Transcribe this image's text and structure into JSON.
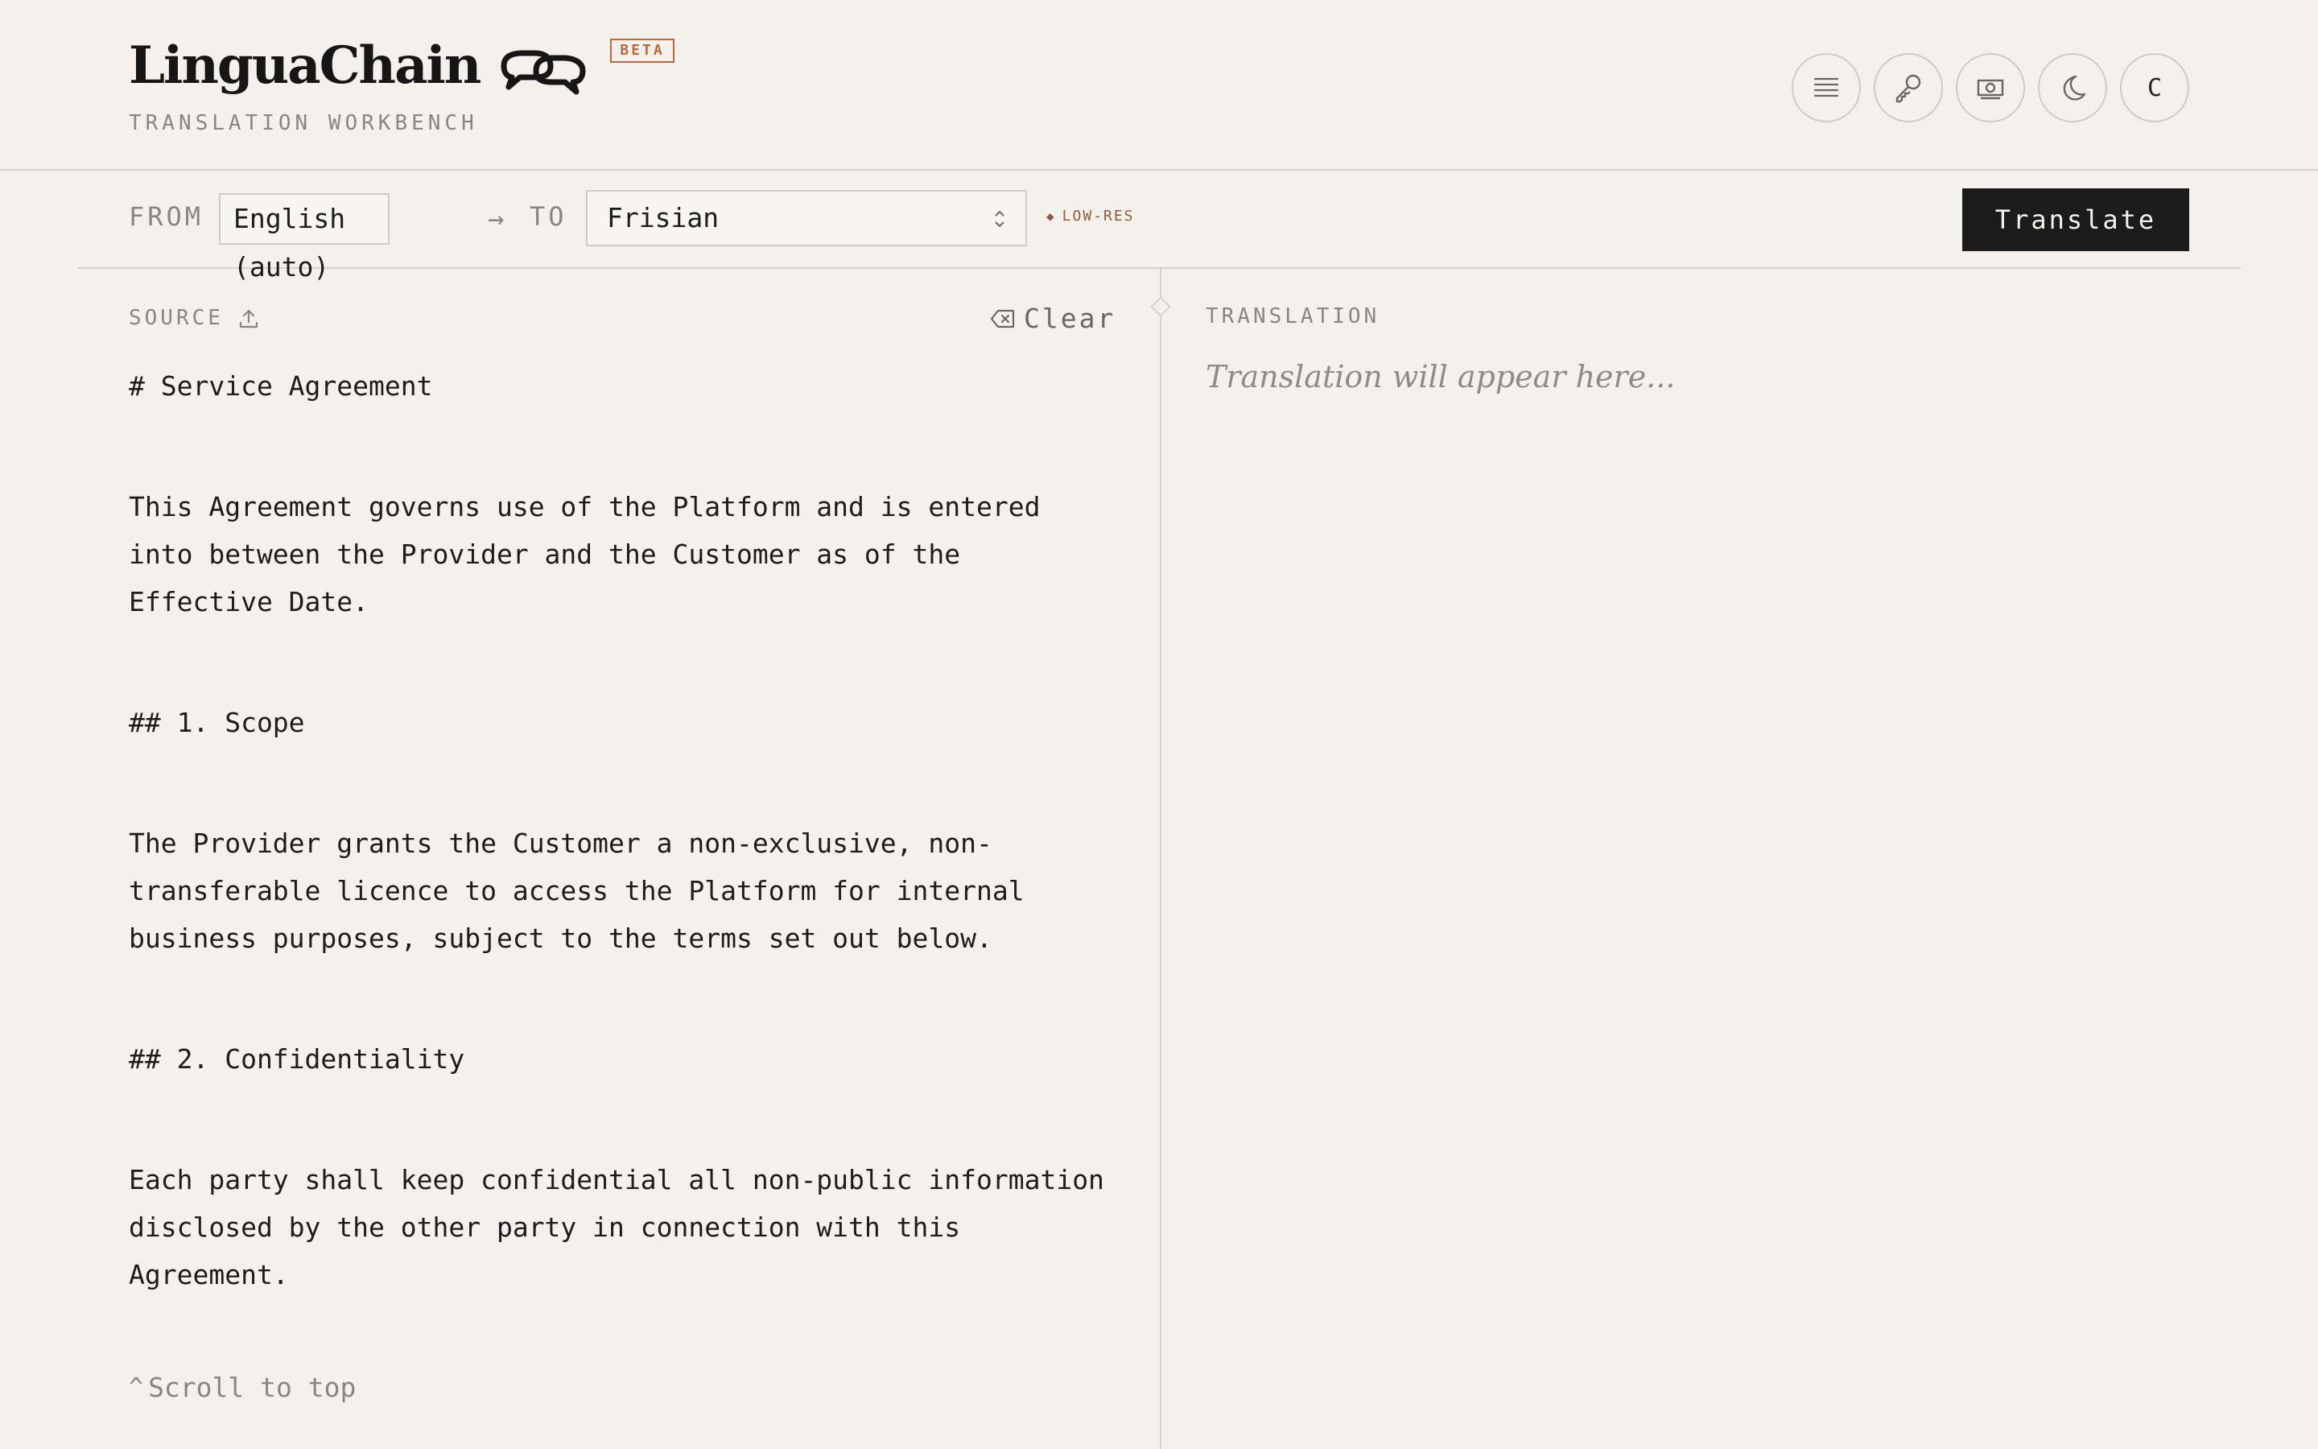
{
  "header": {
    "brand": "LinguaChain",
    "badge": "BETA",
    "subtitle": "TRANSLATION WORKBENCH",
    "icons": [
      "menu-icon",
      "key-icon",
      "money-icon",
      "moon-icon"
    ],
    "avatar_letter": "C"
  },
  "langbar": {
    "from_label": "FROM",
    "source_language": "English (auto)",
    "arrow": "→",
    "to_label": "TO",
    "target_language": "Frisian",
    "resource_badge": "LOW-RES",
    "translate_label": "Translate"
  },
  "source": {
    "label": "SOURCE",
    "clear_label": "Clear",
    "paragraphs": [
      "# Service Agreement",
      "This Agreement governs use of the Platform and is entered into between the Provider and the Customer as of the Effective Date.",
      "## 1. Scope",
      "The Provider grants the Customer a non-exclusive, non-transferable licence to access the Platform for internal business purposes, subject to the terms set out below.",
      "## 2. Confidentiality",
      "Each party shall keep confidential all non-public information disclosed by the other party in connection with this Agreement."
    ],
    "scroll_top_label": "Scroll to top"
  },
  "translation": {
    "label": "TRANSLATION",
    "placeholder": "Translation will appear here..."
  },
  "colors": {
    "background": "#f4f1ed",
    "accent": "#b8693d",
    "button": "#1b1b1b"
  }
}
